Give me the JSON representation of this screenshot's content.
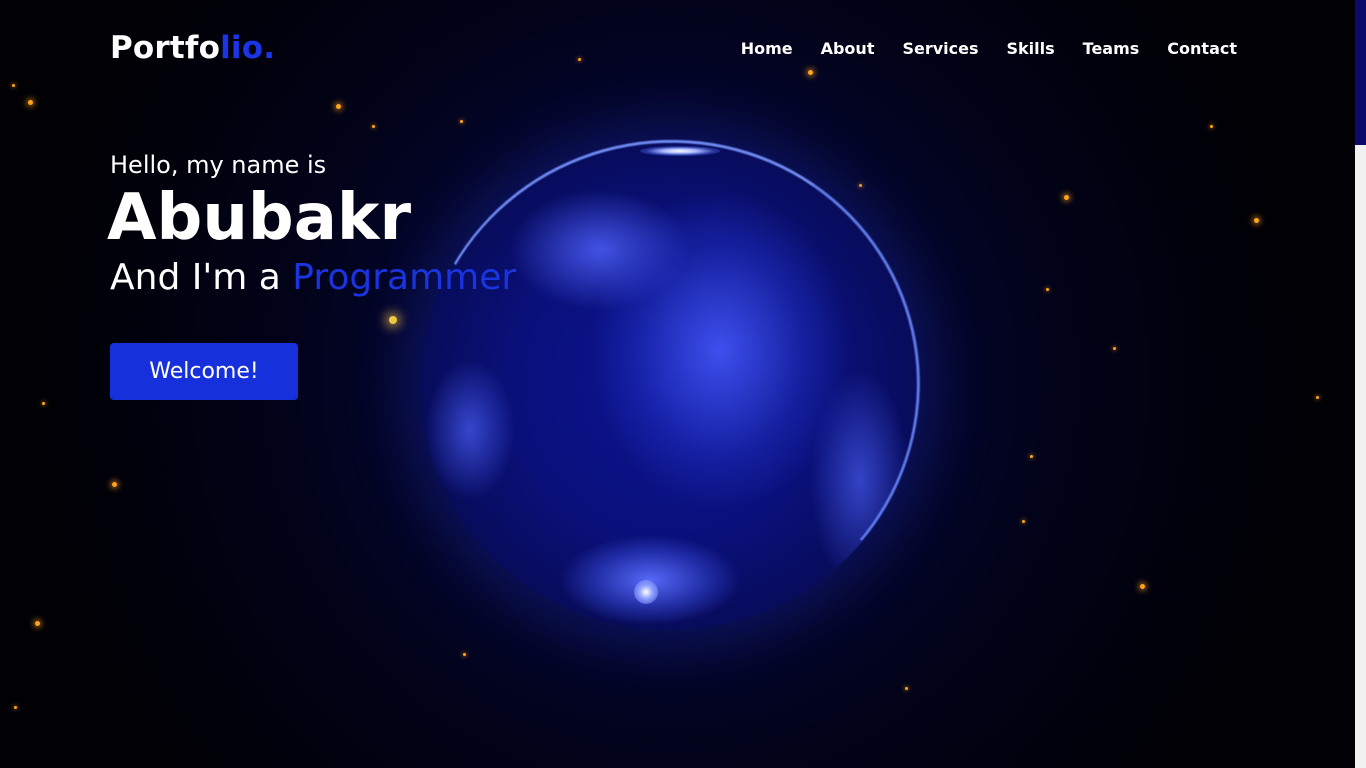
{
  "header": {
    "logo_main": "Portfo",
    "logo_accent": "lio.",
    "nav": [
      "Home",
      "About",
      "Services",
      "Skills",
      "Teams",
      "Contact"
    ]
  },
  "hero": {
    "greeting": "Hello, my name is",
    "name": "Abubakr",
    "role_prefix": "And I'm a ",
    "role_highlight": "Programmer",
    "button_label": "Welcome!"
  },
  "colors": {
    "accent": "#1935e6",
    "background": "#000005",
    "star": "#ffa41c"
  },
  "icons": {
    "background": "particle-globe-image"
  }
}
